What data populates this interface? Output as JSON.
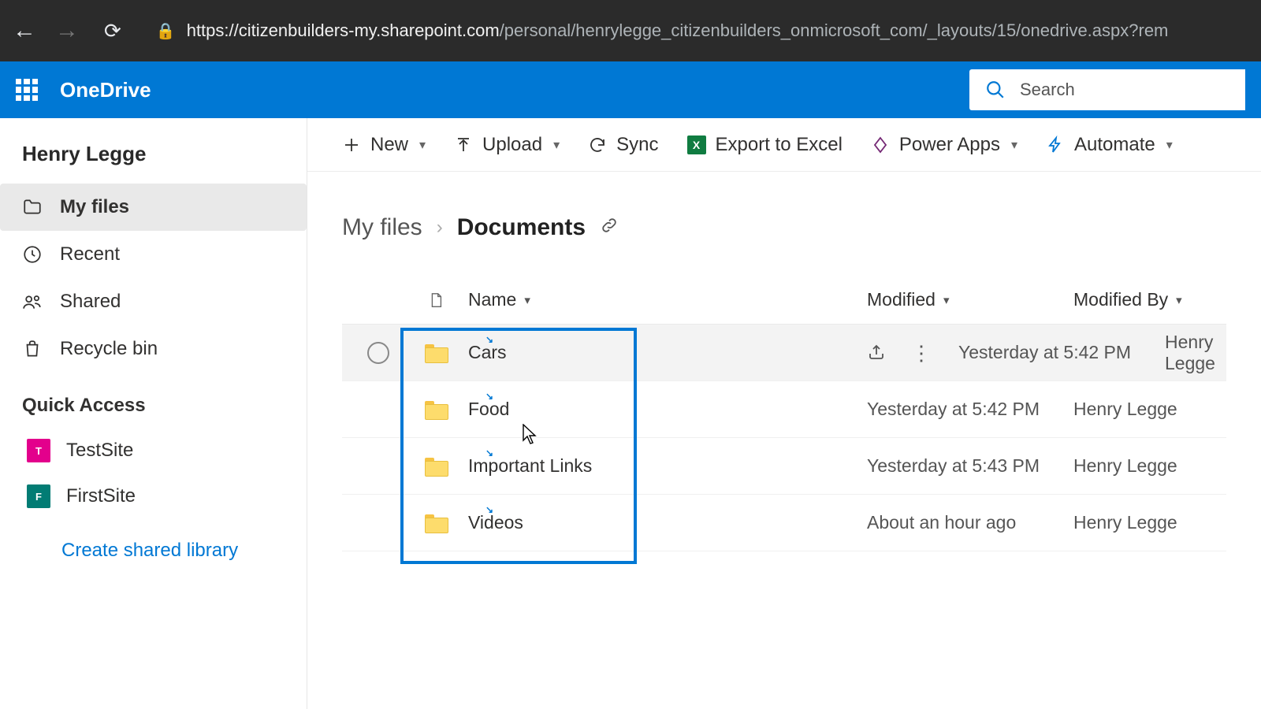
{
  "browser": {
    "url_host": "https://citizenbuilders-my.sharepoint.com",
    "url_path": "/personal/henrylegge_citizenbuilders_onmicrosoft_com/_layouts/15/onedrive.aspx?rem"
  },
  "header": {
    "app_name": "OneDrive",
    "search_placeholder": "Search"
  },
  "sidebar": {
    "user_name": "Henry Legge",
    "items": [
      {
        "label": "My files",
        "active": true
      },
      {
        "label": "Recent",
        "active": false
      },
      {
        "label": "Shared",
        "active": false
      },
      {
        "label": "Recycle bin",
        "active": false
      }
    ],
    "quick_access_heading": "Quick Access",
    "sites": [
      {
        "label": "TestSite",
        "initial": "T",
        "color": "#e3008c"
      },
      {
        "label": "FirstSite",
        "initial": "F",
        "color": "#027c74"
      }
    ],
    "create_library": "Create shared library"
  },
  "commands": {
    "new": "New",
    "upload": "Upload",
    "sync": "Sync",
    "export": "Export to Excel",
    "power_apps": "Power Apps",
    "automate": "Automate"
  },
  "breadcrumb": {
    "root": "My files",
    "current": "Documents"
  },
  "columns": {
    "name": "Name",
    "modified": "Modified",
    "modified_by": "Modified By"
  },
  "rows": [
    {
      "name": "Cars",
      "modified": "Yesterday at 5:42 PM",
      "by": "Henry Legge",
      "hover": true
    },
    {
      "name": "Food",
      "modified": "Yesterday at 5:42 PM",
      "by": "Henry Legge",
      "hover": false
    },
    {
      "name": "Important Links",
      "modified": "Yesterday at 5:43 PM",
      "by": "Henry Legge",
      "hover": false
    },
    {
      "name": "Videos",
      "modified": "About an hour ago",
      "by": "Henry Legge",
      "hover": false
    }
  ]
}
